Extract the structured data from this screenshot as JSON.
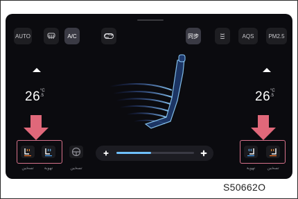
{
  "top_bar": {
    "auto_label": "AUTO",
    "ac_label": "A/C",
    "sync_label": "同步",
    "aqs_label": "AQS",
    "pm25_label": "PM2.5"
  },
  "left_zone": {
    "temperature": "26",
    "unit_top": "°C",
    "unit_bottom": ".5"
  },
  "right_zone": {
    "temperature": "26",
    "unit_top": "°C",
    "unit_bottom": ".5"
  },
  "seat_labels": {
    "left_heat": "تسخين",
    "left_vent": "تهوية",
    "steering": "تسخين",
    "right_vent": "تهوية",
    "right_heat": "تسخين"
  },
  "fan": {
    "level_fraction": 0.45
  },
  "figure_code": "S50662O",
  "colors": {
    "screen": "#0b0b0f",
    "highlight": "#d9738c",
    "arrow": "#e0687a",
    "accent_blue": "#6fc0ff"
  }
}
